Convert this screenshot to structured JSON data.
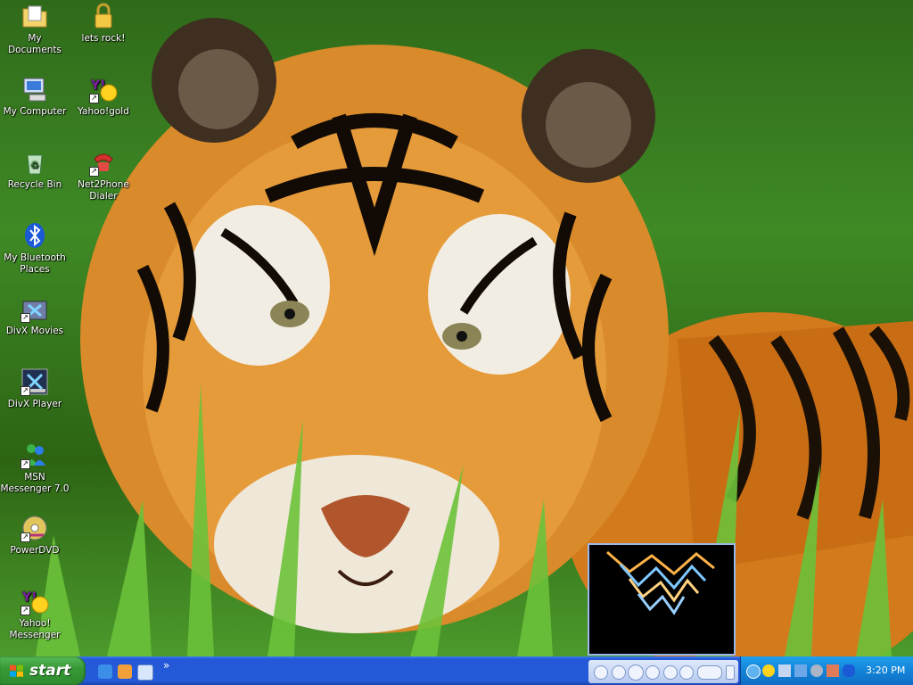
{
  "desktop": {
    "icons": [
      {
        "label": "My Documents"
      },
      {
        "label": "lets rock!"
      },
      {
        "label": "My Computer"
      },
      {
        "label": "Yahoo!gold"
      },
      {
        "label": "Recycle Bin"
      },
      {
        "label": "Net2Phone Dialer"
      },
      {
        "label": "My Bluetooth Places"
      },
      {
        "label": "DivX Movies"
      },
      {
        "label": "DivX Player"
      },
      {
        "label": "MSN Messenger 7.0"
      },
      {
        "label": "PowerDVD"
      },
      {
        "label": "Yahoo! Messenger"
      }
    ]
  },
  "taskbar": {
    "start_label": "start",
    "overflow_chevron": "»",
    "clock": "3:20 PM"
  },
  "colors": {
    "taskbar_blue": "#245ad8",
    "start_green": "#379a37",
    "tray_blue": "#1383d7"
  }
}
